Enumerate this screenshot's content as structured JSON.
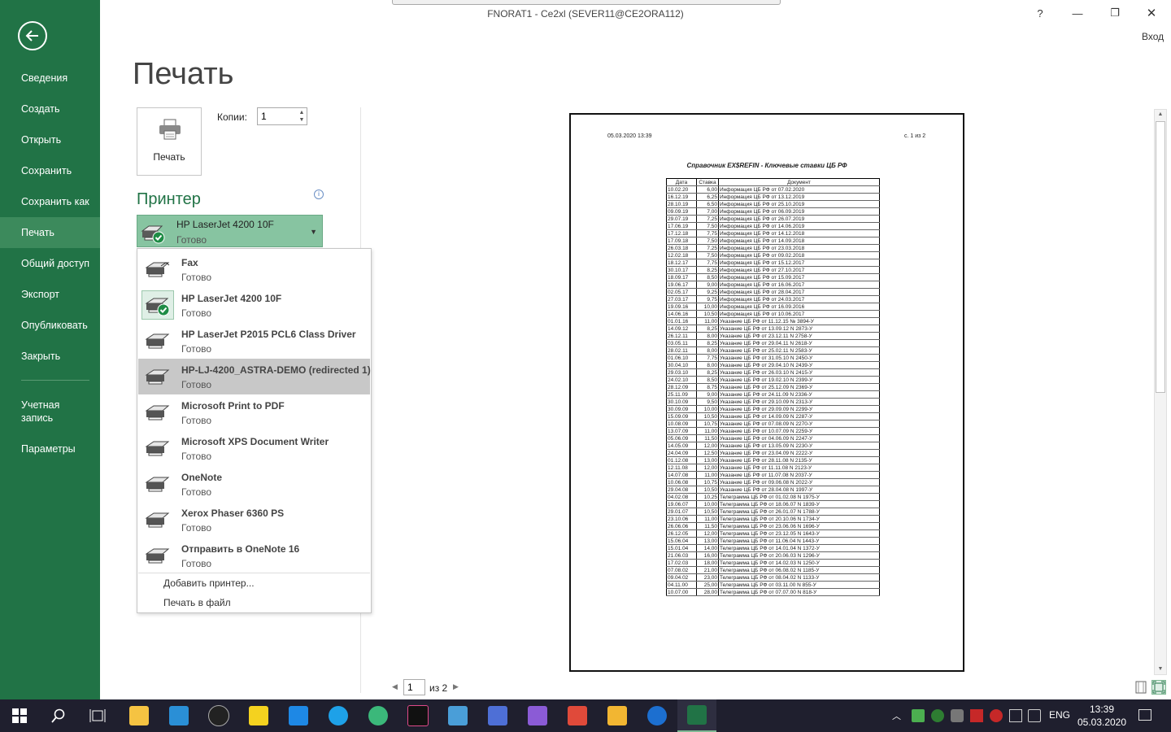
{
  "window": {
    "title": "FNORAT1 - Ce2xl (SEVER11@CE2ORA112)",
    "help_label": "?",
    "minimize_label": "—",
    "restore_label": "❐",
    "close_label": "✕",
    "signin_label": "Вход"
  },
  "nav": {
    "items": [
      {
        "label": "Сведения"
      },
      {
        "label": "Создать"
      },
      {
        "label": "Открыть"
      },
      {
        "label": "Сохранить"
      },
      {
        "label": "Сохранить как"
      },
      {
        "label": "Печать"
      },
      {
        "label": "Общий доступ"
      },
      {
        "label": "Экспорт"
      },
      {
        "label": "Опубликовать"
      },
      {
        "label": "Закрыть"
      },
      {
        "label": "Учетная запись"
      },
      {
        "label": "Параметры"
      }
    ],
    "active_index": 5
  },
  "print": {
    "title": "Печать",
    "button_label": "Печать",
    "copies_label": "Копии:",
    "copies_value": "1",
    "printer_heading": "Принтер",
    "info_glyph": "i",
    "selected_printer": {
      "name": "HP LaserJet 4200 10F",
      "status": "Готово"
    }
  },
  "printers": [
    {
      "name": "Fax",
      "status": "Готово"
    },
    {
      "name": "HP LaserJet 4200 10F",
      "status": "Готово"
    },
    {
      "name": "HP LaserJet P2015 PCL6 Class Driver",
      "status": "Готово"
    },
    {
      "name": "HP-LJ-4200_ASTRA-DEMO (redirected 1)",
      "status": "Готово"
    },
    {
      "name": "Microsoft Print to PDF",
      "status": "Готово"
    },
    {
      "name": "Microsoft XPS Document Writer",
      "status": "Готово"
    },
    {
      "name": "OneNote",
      "status": "Готово"
    },
    {
      "name": "Xerox Phaser 6360 PS",
      "status": "Готово"
    },
    {
      "name": "Отправить в OneNote 16",
      "status": "Готово"
    }
  ],
  "dropdown": {
    "add_printer": "Добавить принтер...",
    "print_to_file": "Печать в файл"
  },
  "preview": {
    "date": "05.03.2020 13:39",
    "page": "с. 1 из 2",
    "title": "Справочник EX$REFIN - Ключевые ставки ЦБ РФ",
    "headers": [
      "Дата",
      "Ставка",
      "Документ"
    ],
    "rows": [
      [
        "10.02.20",
        "6,00",
        "Информация ЦБ РФ от 07.02.2020"
      ],
      [
        "16.12.19",
        "6,25",
        "Информация ЦБ РФ от 13.12.2019"
      ],
      [
        "28.10.19",
        "6,50",
        "Информация ЦБ РФ от 25.10.2019"
      ],
      [
        "09.09.19",
        "7,00",
        "Информация ЦБ РФ от 06.09.2019"
      ],
      [
        "29.07.19",
        "7,25",
        "Информация ЦБ РФ от 26.07.2019"
      ],
      [
        "17.06.19",
        "7,50",
        "Информация ЦБ РФ от 14.06.2019"
      ],
      [
        "17.12.18",
        "7,75",
        "Информация ЦБ РФ от 14.12.2018"
      ],
      [
        "17.09.18",
        "7,50",
        "Информация ЦБ РФ от 14.09.2018"
      ],
      [
        "26.03.18",
        "7,25",
        "Информация ЦБ РФ от 23.03.2018"
      ],
      [
        "12.02.18",
        "7,50",
        "Информация ЦБ РФ от 09.02.2018"
      ],
      [
        "18.12.17",
        "7,75",
        "Информация ЦБ РФ от 15.12.2017"
      ],
      [
        "30.10.17",
        "8,25",
        "Информация ЦБ РФ от 27.10.2017"
      ],
      [
        "18.09.17",
        "8,50",
        "Информация ЦБ РФ от 15.09.2017"
      ],
      [
        "19.06.17",
        "9,00",
        "Информация ЦБ РФ от 16.06.2017"
      ],
      [
        "02.05.17",
        "9,25",
        "Информация ЦБ РФ от 28.04.2017"
      ],
      [
        "27.03.17",
        "9,75",
        "Информация ЦБ РФ от 24.03.2017"
      ],
      [
        "19.09.16",
        "10,00",
        "Информация ЦБ РФ от 16.09.2016"
      ],
      [
        "14.06.16",
        "10,50",
        "Информация ЦБ РФ от 10.06.2017"
      ],
      [
        "01.01.16",
        "11,00",
        "Указание ЦБ РФ от 11.12.15 № 3894-У"
      ],
      [
        "14.09.12",
        "8,25",
        "Указание ЦБ РФ от 13.09.12 N 2873-У"
      ],
      [
        "26.12.11",
        "8,00",
        "Указание ЦБ РФ от 23.12.11 N 2758-У"
      ],
      [
        "03.05.11",
        "8,25",
        "Указание ЦБ РФ от 29.04.11 N 2618-У"
      ],
      [
        "28.02.11",
        "8,00",
        "Указание ЦБ РФ от 25.02.11 N 2583-У"
      ],
      [
        "01.06.10",
        "7,75",
        "Указание ЦБ РФ от 31.05.10 N 2450-У"
      ],
      [
        "30.04.10",
        "8,00",
        "Указание ЦБ РФ от 29.04.10 N 2439-У"
      ],
      [
        "29.03.10",
        "8,25",
        "Указание ЦБ РФ от 26.03.10 N 2415-У"
      ],
      [
        "24.02.10",
        "8,50",
        "Указание ЦБ РФ от 19.02.10 N 2399-У"
      ],
      [
        "28.12.09",
        "8,75",
        "Указание ЦБ РФ от 25.12.09 N 2369-У"
      ],
      [
        "25.11.09",
        "9,00",
        "Указание ЦБ РФ от 24.11.09 N 2336-У"
      ],
      [
        "30.10.09",
        "9,50",
        "Указание ЦБ РФ от 29.10.09 N 2313-У"
      ],
      [
        "30.09.09",
        "10,00",
        "Указание ЦБ РФ от 29.09.09 N 2299-У"
      ],
      [
        "15.09.09",
        "10,50",
        "Указание ЦБ РФ от 14.09.09 N 2287-У"
      ],
      [
        "10.08.09",
        "10,75",
        "Указание ЦБ РФ от 07.08.09 N 2270-У"
      ],
      [
        "13.07.09",
        "11,00",
        "Указание ЦБ РФ от 10.07.09 N 2259-У"
      ],
      [
        "05.06.09",
        "11,50",
        "Указание ЦБ РФ от 04.06.09 N 2247-У"
      ],
      [
        "14.05.09",
        "12,00",
        "Указание ЦБ РФ от 13.05.09 N 2230-У"
      ],
      [
        "24.04.09",
        "12,50",
        "Указание ЦБ РФ от 23.04.09 N 2222-У"
      ],
      [
        "01.12.08",
        "13,00",
        "Указание ЦБ РФ от 28.11.08 N 2135-У"
      ],
      [
        "12.11.08",
        "12,00",
        "Указание ЦБ РФ от 11.11.08 N 2123-У"
      ],
      [
        "14.07.08",
        "11,00",
        "Указание ЦБ РФ от 11.07.08 N 2037-У"
      ],
      [
        "10.06.08",
        "10,75",
        "Указание ЦБ РФ от 09.06.08 N 2022-У"
      ],
      [
        "29.04.08",
        "10,50",
        "Указание ЦБ РФ от 28.04.08 N 1997-У"
      ],
      [
        "04.02.08",
        "10,25",
        "Телеграмма ЦБ РФ от 01.02.08 N 1975-У"
      ],
      [
        "19.06.07",
        "10,00",
        "Телеграмма ЦБ РФ от 18.06.07 N 1839-У"
      ],
      [
        "29.01.07",
        "10,50",
        "Телеграмма ЦБ РФ от 26.01.07 N 1788-У"
      ],
      [
        "23.10.06",
        "11,00",
        "Телеграмма ЦБ РФ от 20.10.06 N 1734-У"
      ],
      [
        "26.06.06",
        "11,50",
        "Телеграмма ЦБ РФ от 23.06.06 N 1696-У"
      ],
      [
        "26.12.05",
        "12,00",
        "Телеграмма ЦБ РФ от 23.12.05 N 1643-У"
      ],
      [
        "15.06.04",
        "13,00",
        "Телеграмма ЦБ РФ от 11.06.04 N 1443-У"
      ],
      [
        "15.01.04",
        "14,00",
        "Телеграмма ЦБ РФ от 14.01.04 N 1372-У"
      ],
      [
        "21.06.03",
        "16,00",
        "Телеграмма ЦБ РФ от 20.06.03 N 1296-У"
      ],
      [
        "17.02.03",
        "18,00",
        "Телеграмма ЦБ РФ от 14.02.03 N 1250-У"
      ],
      [
        "07.08.02",
        "21,00",
        "Телеграмма ЦБ РФ от 06.08.02 N 1185-У"
      ],
      [
        "09.04.02",
        "23,00",
        "Телеграмма ЦБ РФ от 08.04.02 N 1133-У"
      ],
      [
        "04.11.00",
        "25,00",
        "Телеграмма ЦБ РФ от 03.11.00 N 855-У"
      ],
      [
        "10.07.00",
        "28,00",
        "Телеграмма ЦБ РФ от 07.07.00 N 818-У"
      ]
    ]
  },
  "pager": {
    "current": "1",
    "of_label": "из 2",
    "prev_glyph": "◀",
    "next_glyph": "▶"
  },
  "taskbar": {
    "language": "ENG",
    "time": "13:39",
    "date": "05.03.2020",
    "apps": [
      {
        "name": "start",
        "color": "#ffffff"
      },
      {
        "name": "search",
        "color": "#ffffff"
      },
      {
        "name": "task-view",
        "color": "#ffffff"
      },
      {
        "name": "file-explorer",
        "color": "#f5c342"
      },
      {
        "name": "app-blue",
        "color": "#2a8fd6"
      },
      {
        "name": "app-circle",
        "color": "#222222"
      },
      {
        "name": "app-bat",
        "color": "#f4d21f"
      },
      {
        "name": "app-remote",
        "color": "#1e88e5"
      },
      {
        "name": "internet-explorer",
        "color": "#1ea1e8"
      },
      {
        "name": "app-map",
        "color": "#3bb87a"
      },
      {
        "name": "intellij",
        "color": "#111111"
      },
      {
        "name": "app-monitor",
        "color": "#4a9ed8"
      },
      {
        "name": "app-save",
        "color": "#4e6fd6"
      },
      {
        "name": "visual-studio",
        "color": "#8b5bd6"
      },
      {
        "name": "app-doc",
        "color": "#e04a3a"
      },
      {
        "name": "app-run",
        "color": "#f2b632"
      },
      {
        "name": "ce2",
        "color": "#1c6fd0"
      },
      {
        "name": "excel",
        "color": "#217346"
      }
    ]
  }
}
